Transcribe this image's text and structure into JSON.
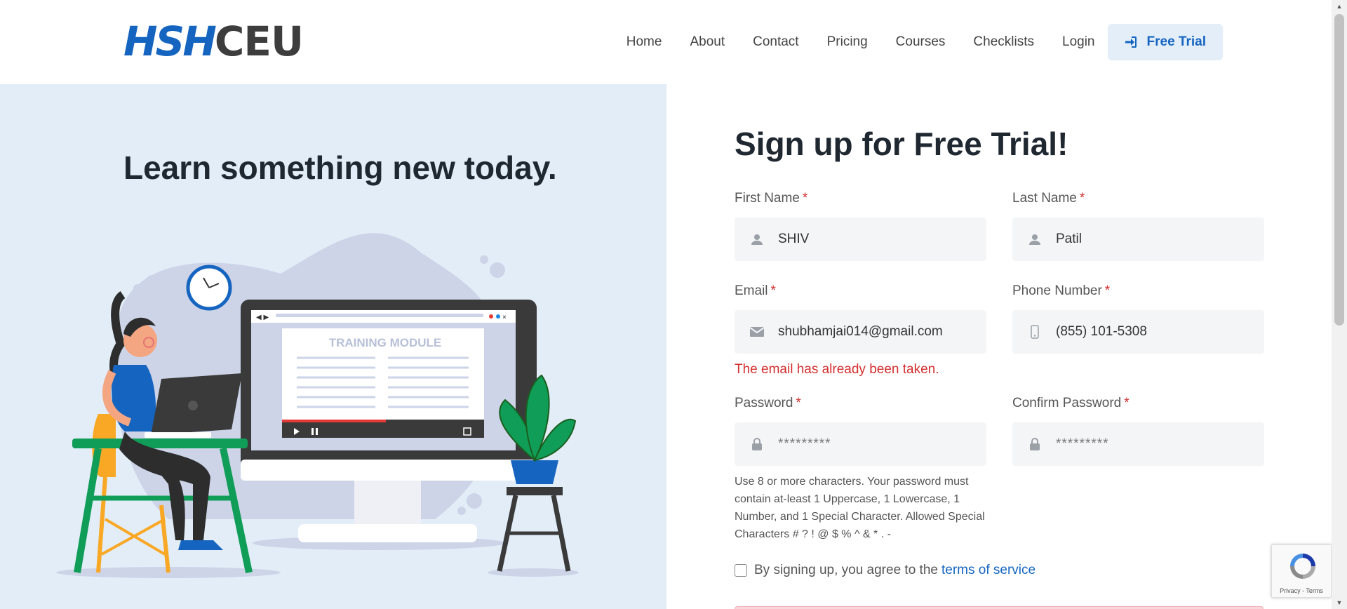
{
  "header": {
    "logo_part1": "HSH",
    "logo_part2": "CEU",
    "nav": [
      "Home",
      "About",
      "Contact",
      "Pricing",
      "Courses",
      "Checklists",
      "Login"
    ],
    "trial_button": "Free Trial"
  },
  "hero": {
    "title": "Learn something new today.",
    "illustration_label": "TRAINING MODULE"
  },
  "form": {
    "title": "Sign up for Free Trial!",
    "required_mark": "*",
    "first_name": {
      "label": "First Name",
      "value": "SHIV",
      "icon": "person-icon"
    },
    "last_name": {
      "label": "Last Name",
      "value": "Patil",
      "icon": "person-icon"
    },
    "email": {
      "label": "Email",
      "value": "shubhamjai014@gmail.com",
      "icon": "envelope-icon",
      "error": "The email has already been taken."
    },
    "phone": {
      "label": "Phone Number",
      "value": "(855) 101-5308",
      "icon": "phone-icon"
    },
    "password": {
      "label": "Password",
      "value": "*********",
      "icon": "lock-icon",
      "hint": "Use 8 or more characters. Your password must contain at-least 1 Uppercase, 1 Lowercase, 1 Number, and 1 Special Character. Allowed Special Characters # ? ! @ $ % ^ & * . -"
    },
    "confirm_password": {
      "label": "Confirm Password",
      "value": "*********",
      "icon": "lock-icon"
    },
    "agree_text": "By signing up, you agree to the",
    "terms_link": "terms of service"
  },
  "recaptcha": {
    "text": "Privacy - Terms"
  },
  "colors": {
    "accent": "#1565c0",
    "error": "#d32f2f",
    "hero_bg": "#e2edf7",
    "input_bg": "#f3f5f7"
  }
}
